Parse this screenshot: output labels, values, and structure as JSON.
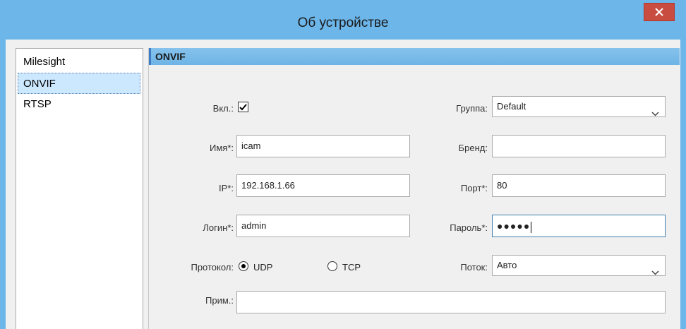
{
  "window": {
    "title": "Об устройстве"
  },
  "sidebar": {
    "items": [
      {
        "label": "Milesight"
      },
      {
        "label": "ONVIF",
        "selected": true
      },
      {
        "label": "RTSP"
      }
    ]
  },
  "panel": {
    "header": "ONVIF"
  },
  "form": {
    "enabled_label": "Вкл.:",
    "enabled_checked": true,
    "group_label": "Группа:",
    "group_value": "Default",
    "name_label": "Имя*:",
    "name_value": "icam",
    "brand_label": "Бренд:",
    "brand_value": "",
    "ip_label": "IP*:",
    "ip_value": "192.168.1.66",
    "port_label": "Порт*:",
    "port_value": "80",
    "login_label": "Логин*:",
    "login_value": "admin",
    "password_label": "Пароль*:",
    "password_value": "●●●●●",
    "protocol_label": "Протокол:",
    "protocol_options": [
      "UDP",
      "TCP"
    ],
    "protocol_selected": "UDP",
    "stream_label": "Поток:",
    "stream_value": "Авто",
    "note_label": "Прим.:",
    "note_value": ""
  },
  "colors": {
    "titlebar": "#6cb6ea",
    "close_button": "#c84c40",
    "selection": "#cce8ff",
    "header": "#6eb4e6"
  },
  "icons": {
    "close": "close-icon",
    "checkmark": "checkmark-icon",
    "dropdown": "chevron-down-icon"
  }
}
